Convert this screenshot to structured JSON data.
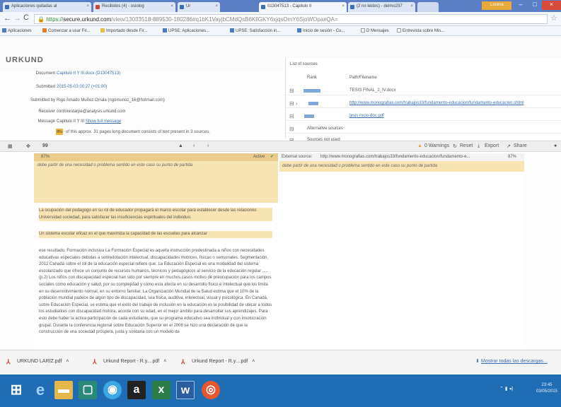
{
  "browser": {
    "tabs": [
      {
        "label": "Aplicaciones quitadas al"
      },
      {
        "label": "Recibidos (4) - osiolog"
      },
      {
        "label": "Ur"
      },
      {
        "label": "013047513 - Capitulo II"
      },
      {
        "label": "(2 no leidos) - delmo237"
      }
    ],
    "user_badge": "Lorena",
    "url_secure": "https://",
    "url_host": "secure.urkund.com",
    "url_path": "/view/13033518-889530-180286#q1bK1VayjbCMdQsB6KllGKY6xjqsOmY6SjoWOpaxQA=",
    "bookmarks": [
      "Aplicaciones",
      "Comenzar a usar Fir...",
      "Importado desde Fir...",
      "UPSE: Aplicaciones...",
      "UPSE: Satisfacción in...",
      "Inicio de sesión - Cu...",
      "D Mensajes",
      "Entrevista sobre Mis..."
    ]
  },
  "urkund": {
    "logo": "URKUND",
    "document_label": "Document",
    "document_value": "Capitulo II Y III.docx (D13047513)",
    "submitted_label": "Submitted",
    "submitted_value": "2015-05-03 00:27 (+01:00)",
    "submitted_by_label": "Submitted by",
    "submitted_by_value": "Rigo Amado Muñoz Orrala (rigomunoz_16@hotmail.com)",
    "receiver_label": "Receiver",
    "receiver_value": "conforestarpe@analysis.urkund.com",
    "message_label": "Message",
    "message_value": "Capitulo II Y III",
    "show_full_message": "Show full message",
    "percent_badge": "8%",
    "summary": "of this approx. 31 pages long document consists of text present in 3 sources."
  },
  "sources": {
    "title": "List of sources",
    "col_rank": "Rank",
    "col_path": "Path/Filename",
    "rows": [
      {
        "path": "TESIS FINAL_2_IV.docx",
        "link": false
      },
      {
        "path": "http://www.monografias.com/trabajos33/fundamento-educacion/fundamento-educacion.shtml",
        "link": true
      },
      {
        "path": "tesis rocio-doc.pdf",
        "link": true
      },
      {
        "path": "Alternative sources",
        "link": false
      },
      {
        "path": "Sources not used",
        "link": false
      }
    ]
  },
  "toolbar": {
    "warnings": "0 Warnings",
    "reset": "Reset",
    "export": "Export",
    "share": "Share"
  },
  "match": {
    "percent": "87%",
    "status": "Active",
    "quote": "debe partir de una necesidad o problema sentido en este caso su punto de partida",
    "external_label": "External source:",
    "external_url": "http://www.monografias.com/trabajos33/fundamento-educacion/fundamento-e...",
    "external_pct": "87%",
    "external_quote": "debe partir de una necesidad o problema sentido en este caso su punto de partida"
  },
  "document_text": {
    "p1": "La ocupación del pedagogo en su rol de educador propagará el marco escolar para establecer desde las relaciones Universidad sociedad, para satisfacer las insuficiencias espirituales del individuo.",
    "p2": "Un sistema escolar eficaz es el que maximiza la capacidad de las escuelas para alcanzar",
    "p3": "ese resultado. Formación inclusiva La Formación Especial es aquella instrucción predestinada a niños con necesidades educativas especiales debidas a sobredotación intelectual, discapacidades motrices, físicas o sensoriales. Segmentación, 2012 Canadá sobre el rol de la educación especial refiere que: La Educación Especial es una modalidad del sistema escolarizado que ofrece un conjunto de recursos humanos, técnicos y pedagógicos al servicio de la educación regular ..... (p.2) Los niños con discapacidad especial han sido por siempre en muchos casos motivo de preocupación para los campos sociales como educación y salud, por su complejidad y cómo esta afecta en su desarrollo físico e intelectual que los limita en su desenvolvimiento normal, en su entorno familiar. La Organización Mundial de la Salud estima que el 10% de la población mundial padece de algún tipo de discapacidad, sea física, auditiva, intelectual, visual y psicológica. En Canadá, sobre Educación Especial, se estima que el éxito del trabajo de inclusión en la educación es la posibilidad de ubicar a todos los estudiantes con discapacidad motora, acorde con su edad, en el mejor ámbito para desarrollar sus aprendizajes. Para esto debe haber la activa participación de cada estudiante, que su programa educativo sea individual y con involucración grupal. Durante la conferencia regional sobre Educación Superior en el 2008 se hizo una declaración de que la construcción de una sociedad próspera, justa y solidaria con un modelo de"
  },
  "downloads": {
    "items": [
      "URKUND LARIZ.pdf",
      "Urkund Report - R.y....pdf",
      "Urkund Report - R.y....pdf"
    ],
    "show_all": "Mostrar todas las descargas..."
  },
  "taskbar": {
    "time": "23:45",
    "date": "03/05/2015"
  }
}
